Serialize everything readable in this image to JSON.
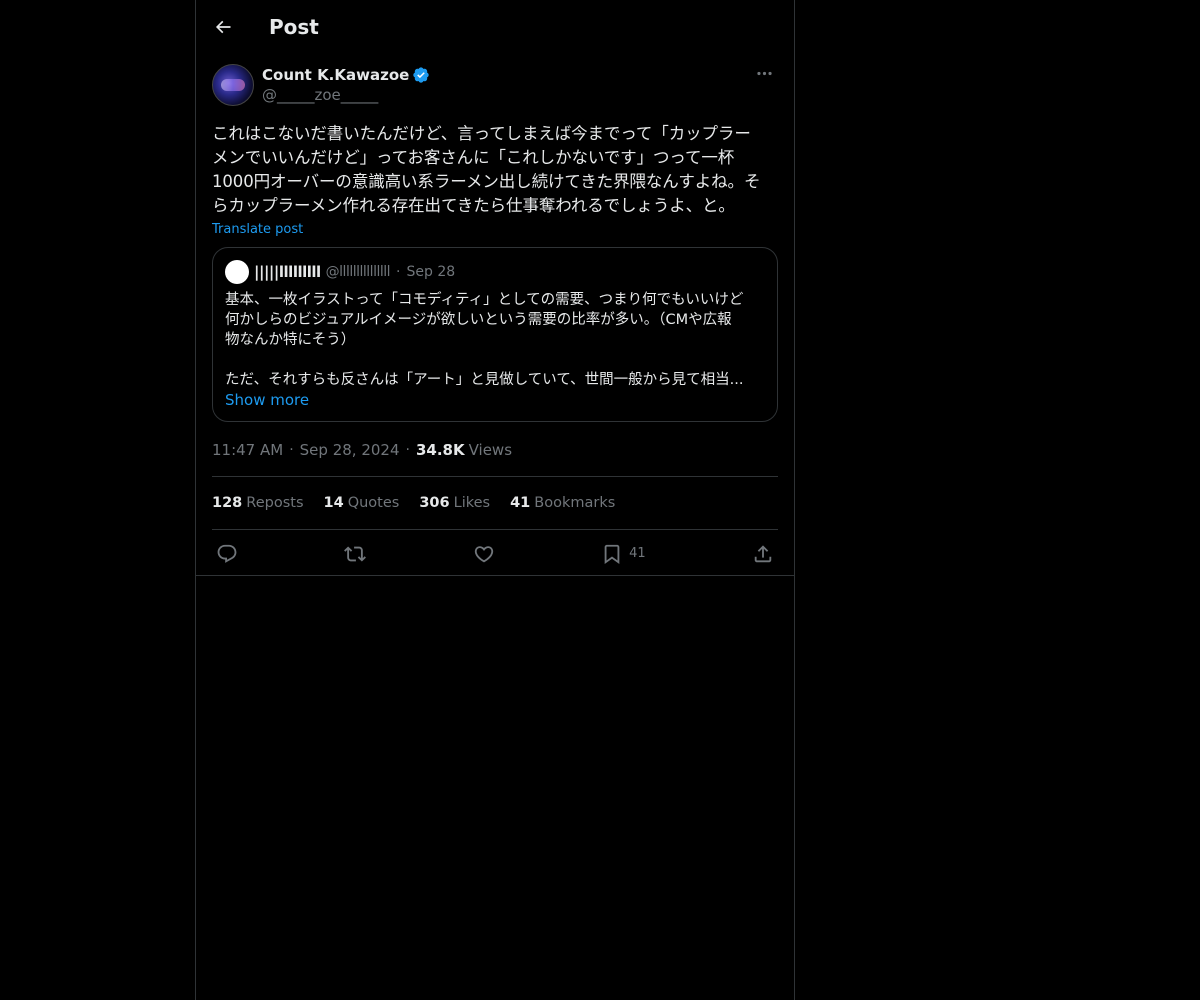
{
  "header": {
    "title": "Post"
  },
  "author": {
    "name": "Count K.Kawazoe",
    "handle": "@_____zoe_____",
    "verified": true
  },
  "post": {
    "text": "これはこないだ書いたんだけど、言ってしまえば今までって「カップラー\nメンでいいんだけど」ってお客さんに「これしかないです」つって一杯\n1000円オーバーの意識高い系ラーメン出し続けてきた界隈なんすよね。そ\nらカップラーメン作れる存在出てきたら仕事奪われるでしょうよ、と。",
    "translate_label": "Translate post"
  },
  "quote": {
    "name": "|||||lllllllll",
    "handle": "@lllllllllllllll",
    "separator": "·",
    "date": "Sep 28",
    "text": "基本、一枚イラストって「コモディティ」としての需要、つまり何でもいいけど\n何かしらのビジュアルイメージが欲しいという需要の比率が多い。（CMや広報\n物なんか特にそう）\n\nただ、それすらも反さんは「アート」と見做していて、世間一般から見て相当...",
    "show_more": "Show more"
  },
  "meta": {
    "time": "11:47 AM",
    "separator": "·",
    "date": "Sep 28, 2024",
    "views_count": "34.8K",
    "views_label": "Views"
  },
  "stats": {
    "reposts_count": "128",
    "reposts_label": "Reposts",
    "quotes_count": "14",
    "quotes_label": "Quotes",
    "likes_count": "306",
    "likes_label": "Likes",
    "bookmarks_count": "41",
    "bookmarks_label": "Bookmarks"
  },
  "actions": {
    "bookmark_count": "41"
  },
  "icons": {
    "back": "arrow-left-icon",
    "more": "more-horizontal-icon",
    "verified": "verified-badge-icon",
    "reply": "reply-icon",
    "repost": "repost-icon",
    "like": "heart-icon",
    "bookmark": "bookmark-icon",
    "share": "share-icon"
  },
  "colors": {
    "accent": "#1d9bf0",
    "background": "#000000",
    "text": "#e7e9ea",
    "muted": "#71767b",
    "border": "#2f3336"
  }
}
